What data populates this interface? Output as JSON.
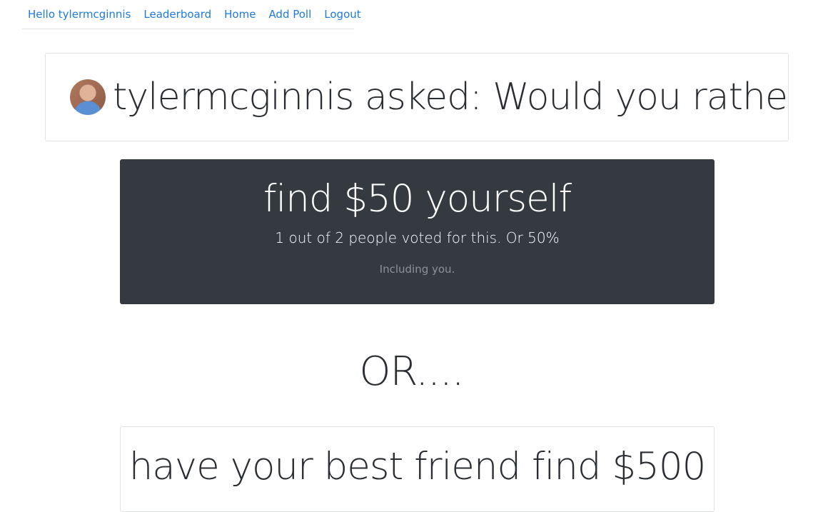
{
  "nav": {
    "items": [
      {
        "label": "Hello tylermcginnis"
      },
      {
        "label": "Leaderboard"
      },
      {
        "label": "Home"
      },
      {
        "label": "Add Poll"
      },
      {
        "label": "Logout"
      }
    ]
  },
  "question": {
    "title": "tylermcginnis asked: Would you rather..."
  },
  "options": [
    {
      "text": "find $50 yourself",
      "votes_text": "1 out of 2 people voted for this. Or 50%",
      "note": "Including you."
    },
    {
      "text": "have your best friend find $500"
    }
  ],
  "separator": "OR...."
}
